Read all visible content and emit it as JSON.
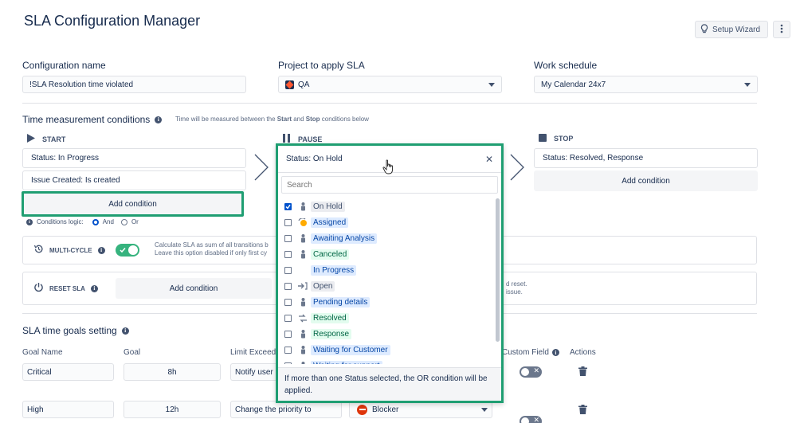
{
  "header": {
    "title": "SLA Configuration Manager",
    "wizard_label": "Setup Wizard"
  },
  "config": {
    "name_label": "Configuration name",
    "name_value": "!SLA Resolution time violated",
    "project_label": "Project to apply SLA",
    "project_value": "QA",
    "schedule_label": "Work schedule",
    "schedule_value": "My Calendar 24x7"
  },
  "time_conditions": {
    "title": "Time measurement conditions",
    "hint_pre": "Time will be measured between the ",
    "hint_start": "Start",
    "hint_mid": " and ",
    "hint_stop": "Stop",
    "hint_post": " conditions below",
    "start": {
      "heading": "START",
      "conditions": [
        "Status: In Progress",
        "Issue Created: Is created"
      ],
      "add_label": "Add condition",
      "logic_label": "Conditions logic:",
      "logic_and": "And",
      "logic_or": "Or"
    },
    "pause": {
      "heading": "PAUSE",
      "value": "Status: On Hold"
    },
    "stop": {
      "heading": "STOP",
      "conditions": [
        "Status: Resolved, Response"
      ],
      "add_label": "Add condition"
    }
  },
  "multicycle": {
    "label": "MULTI-CYCLE",
    "desc1": "Calculate SLA as sum of all transitions b",
    "desc2": "Leave this option disabled if only first cy"
  },
  "reset": {
    "label": "RESET SLA",
    "add_label": "Add condition",
    "desc1": "d reset.",
    "desc2": "issue."
  },
  "dropdown": {
    "search_placeholder": "Search",
    "options": [
      {
        "label": "On Hold",
        "checked": true,
        "style": "grey",
        "icon": "person-icon"
      },
      {
        "label": "Assigned",
        "checked": false,
        "style": "blue",
        "icon": "assign-icon"
      },
      {
        "label": "Awaiting Analysis",
        "checked": false,
        "style": "blue",
        "icon": "person-icon"
      },
      {
        "label": "Canceled",
        "checked": false,
        "style": "green",
        "icon": "person-icon"
      },
      {
        "label": "In Progress",
        "checked": false,
        "style": "blue",
        "icon": ""
      },
      {
        "label": "Open",
        "checked": false,
        "style": "grey",
        "icon": "enter-icon"
      },
      {
        "label": "Pending details",
        "checked": false,
        "style": "blue",
        "icon": "person-icon"
      },
      {
        "label": "Resolved",
        "checked": false,
        "style": "green",
        "icon": "resolve-icon"
      },
      {
        "label": "Response",
        "checked": false,
        "style": "green",
        "icon": "person-icon"
      },
      {
        "label": "Waiting for Customer",
        "checked": false,
        "style": "blue",
        "icon": "person-icon"
      },
      {
        "label": "Waiting for support",
        "checked": false,
        "style": "blue",
        "icon": "person-icon"
      }
    ],
    "footer": "If more than one Status selected, the OR condition will be applied."
  },
  "goals": {
    "title": "SLA time goals setting",
    "col_name": "Goal Name",
    "col_goal": "Goal",
    "col_limit": "Limit Exceed",
    "col_custom": "Custom Field",
    "col_actions": "Actions",
    "rows": [
      {
        "name": "Critical",
        "goal": "8h",
        "limit": "Notify user",
        "action_value": ""
      },
      {
        "name": "High",
        "goal": "12h",
        "limit": "Change the priority to",
        "action_value": "Blocker"
      }
    ]
  },
  "colors": {
    "accent_green": "#1f9e72",
    "toggle_green": "#36b37e",
    "primary_blue": "#0052cc"
  }
}
